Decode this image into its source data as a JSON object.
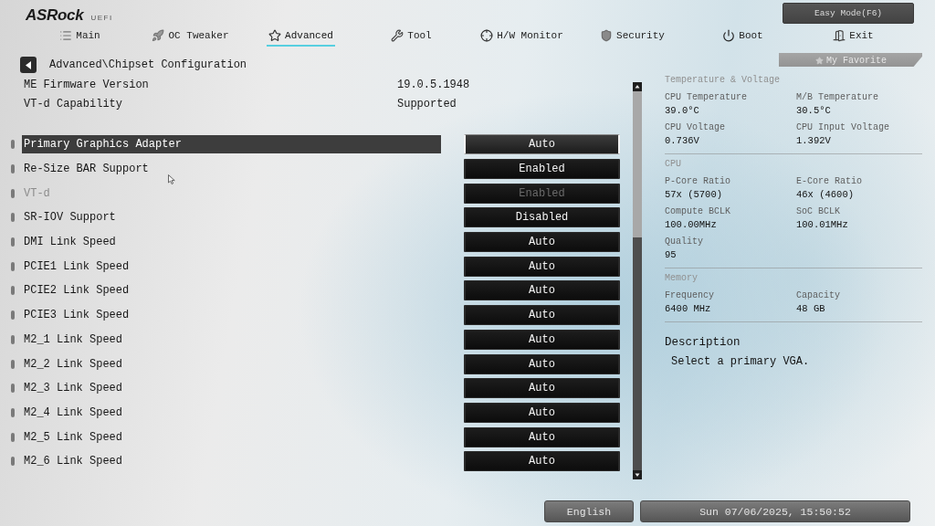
{
  "header": {
    "logo": "ASRock",
    "logo_suffix": "UEFI",
    "mode_button": "Easy Mode(F6)"
  },
  "tabs": [
    {
      "label": "Main",
      "selected": false
    },
    {
      "label": "OC Tweaker",
      "selected": false
    },
    {
      "label": "Advanced",
      "selected": true
    },
    {
      "label": "Tool",
      "selected": false
    },
    {
      "label": "H/W Monitor",
      "selected": false
    },
    {
      "label": "Security",
      "selected": false
    },
    {
      "label": "Boot",
      "selected": false
    },
    {
      "label": "Exit",
      "selected": false
    }
  ],
  "breadcrumb": "Advanced\\Chipset Configuration",
  "favorite_button": "My Favorite",
  "info_rows": [
    {
      "label": "ME Firmware Version",
      "value": "19.0.5.1948"
    },
    {
      "label": "VT-d Capability",
      "value": "Supported"
    }
  ],
  "settings": [
    {
      "label": "Primary Graphics Adapter",
      "value": "Auto",
      "selected": true,
      "disabled": false
    },
    {
      "label": "Re-Size BAR Support",
      "value": "Enabled",
      "selected": false,
      "disabled": false
    },
    {
      "label": "VT-d",
      "value": "Enabled",
      "selected": false,
      "disabled": true
    },
    {
      "label": "SR-IOV Support",
      "value": "Disabled",
      "selected": false,
      "disabled": false
    },
    {
      "label": "DMI Link Speed",
      "value": "Auto",
      "selected": false,
      "disabled": false
    },
    {
      "label": "PCIE1 Link Speed",
      "value": "Auto",
      "selected": false,
      "disabled": false
    },
    {
      "label": "PCIE2 Link Speed",
      "value": "Auto",
      "selected": false,
      "disabled": false
    },
    {
      "label": "PCIE3 Link Speed",
      "value": "Auto",
      "selected": false,
      "disabled": false
    },
    {
      "label": "M2_1 Link Speed",
      "value": "Auto",
      "selected": false,
      "disabled": false
    },
    {
      "label": "M2_2 Link Speed",
      "value": "Auto",
      "selected": false,
      "disabled": false
    },
    {
      "label": "M2_3 Link Speed",
      "value": "Auto",
      "selected": false,
      "disabled": false
    },
    {
      "label": "M2_4 Link Speed",
      "value": "Auto",
      "selected": false,
      "disabled": false
    },
    {
      "label": "M2_5 Link Speed",
      "value": "Auto",
      "selected": false,
      "disabled": false
    },
    {
      "label": "M2_6 Link Speed",
      "value": "Auto",
      "selected": false,
      "disabled": false
    }
  ],
  "monitor": {
    "sections": [
      {
        "title": "Temperature & Voltage",
        "items": [
          {
            "label": "CPU Temperature",
            "value": "39.0°C"
          },
          {
            "label": "M/B Temperature",
            "value": "30.5°C"
          },
          {
            "label": "CPU Voltage",
            "value": "0.736V"
          },
          {
            "label": "CPU Input Voltage",
            "value": "1.392V"
          }
        ]
      },
      {
        "title": "CPU",
        "items": [
          {
            "label": "P-Core Ratio",
            "value": "57x (5700)"
          },
          {
            "label": "E-Core Ratio",
            "value": "46x (4600)"
          },
          {
            "label": "Compute BCLK",
            "value": "100.00MHz"
          },
          {
            "label": "SoC BCLK",
            "value": "100.01MHz"
          },
          {
            "label": "Quality",
            "value": "95"
          }
        ]
      },
      {
        "title": "Memory",
        "items": [
          {
            "label": "Frequency",
            "value": "6400 MHz"
          },
          {
            "label": "Capacity",
            "value": "48 GB"
          }
        ]
      }
    ]
  },
  "description": {
    "title": "Description",
    "text": "Select a primary VGA."
  },
  "status_bar": {
    "language": "English",
    "datetime": "Sun 07/06/2025, 15:50:52"
  }
}
